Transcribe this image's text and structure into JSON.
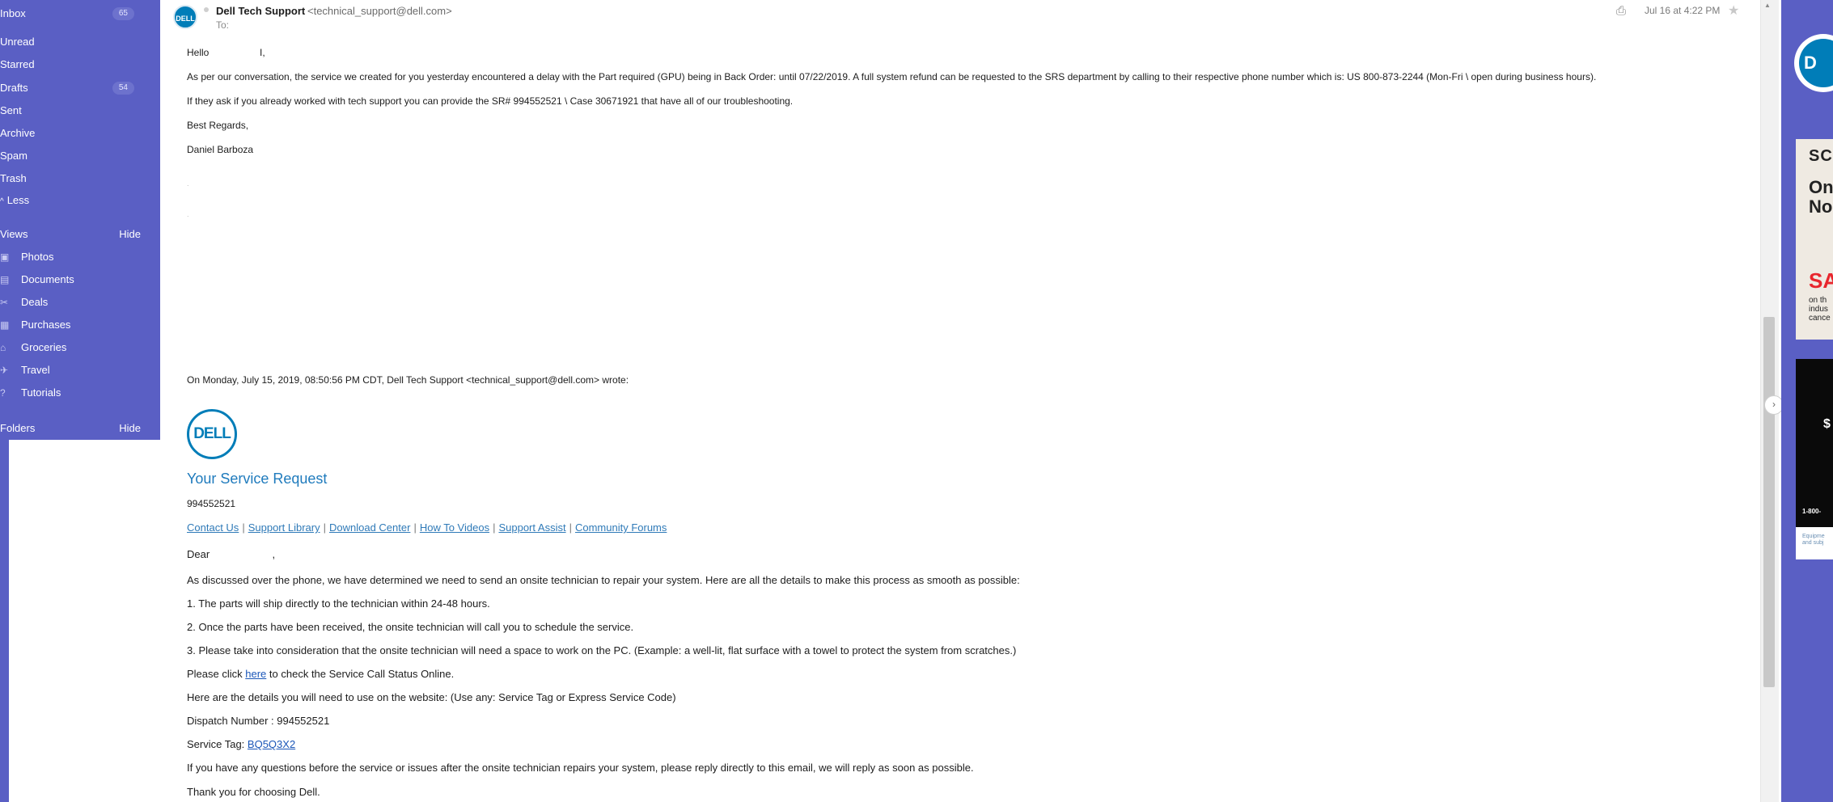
{
  "sidebar": {
    "folders_main": [
      {
        "label": "Inbox",
        "badge": "65"
      },
      {
        "label": "Unread",
        "badge": ""
      },
      {
        "label": "Starred",
        "badge": ""
      },
      {
        "label": "Drafts",
        "badge": "54"
      },
      {
        "label": "Sent",
        "badge": ""
      },
      {
        "label": "Archive",
        "badge": ""
      },
      {
        "label": "Spam",
        "badge": ""
      },
      {
        "label": "Trash",
        "badge": ""
      }
    ],
    "less_label": "Less",
    "views_header": "Views",
    "views_hide": "Hide",
    "views": [
      {
        "label": "Photos",
        "icon": "photo-icon"
      },
      {
        "label": "Documents",
        "icon": "document-icon"
      },
      {
        "label": "Deals",
        "icon": "scissors-icon"
      },
      {
        "label": "Purchases",
        "icon": "receipt-icon"
      },
      {
        "label": "Groceries",
        "icon": "basket-icon"
      },
      {
        "label": "Travel",
        "icon": "plane-icon"
      },
      {
        "label": "Tutorials",
        "icon": "help-icon"
      }
    ],
    "folders_header": "Folders",
    "folders_hide": "Hide"
  },
  "email": {
    "avatar_text": "DELL",
    "from_name": "Dell Tech Support",
    "from_address": "<technical_support@dell.com>",
    "to_label": "To:",
    "date": "Jul 16 at 4:22 PM",
    "greeting": "Hello",
    "greeting_end": "I,",
    "p1": "As per our conversation, the service we created for you yesterday encountered a delay with the Part required (GPU) being in Back Order: until 07/22/2019. A full system refund can be requested to the SRS department by calling to their respective phone number which is: US 800-873-2244 (Mon-Fri \\ open during business hours).",
    "p2": "If they ask if you already worked with tech support you can provide the SR# 994552521 \\ Case 30671921 that have all of our troubleshooting.",
    "signoff": "Best Regards,",
    "signer": "Daniel Barboza",
    "quote_header": "On Monday, July 15, 2019, 08:50:56 PM CDT, Dell Tech Support <technical_support@dell.com> wrote:"
  },
  "quoted": {
    "logo_text": "DELL",
    "title": "Your Service Request",
    "number": "994552521",
    "links": [
      "Contact Us",
      "Support Library",
      "Download Center",
      "How To Videos",
      "Support Assist",
      "Community Forums"
    ],
    "dear": "Dear",
    "dear_end": ",",
    "intro": "As discussed over the phone, we have determined we need to send an onsite technician to repair your system. Here are all the details to make this process as smooth as possible:",
    "step1": "1. The parts will ship directly to the technician within 24-48 hours.",
    "step2": "2. Once the parts have been received, the onsite technician will call you to schedule the service.",
    "step3": "3. Please take into consideration that the onsite technician will need a space to work on the PC. (Example: a well-lit, flat surface with a towel to protect the system from scratches.)",
    "click_pre": "Please click",
    "click_link": "here",
    "click_post": "to check the Service Call Status Online.",
    "details": "Here are the details you will need to use on the website: (Use any: Service Tag or Express Service Code)",
    "dispatch": "Dispatch Number : 994552521",
    "tag_label": "Service Tag:",
    "tag_value": "BQ5Q3X2",
    "questions": "If you have any questions before the service or issues after the onsite technician repairs your system, please reply directly to this email, we will reply as soon as possible.",
    "thanks": "Thank you for choosing Dell."
  },
  "ads": {
    "ad1_line1": "SC",
    "ad1_line2": "On",
    "ad1_line3": "No",
    "ad1_sale": "SA",
    "ad1_small": "on th indus cance",
    "ad2_price": "$",
    "ad2_phone": "1-800-",
    "ad2_fine": "Equipme and subj"
  },
  "colors": {
    "sidebar_bg": "#5a5fc4",
    "dell_blue": "#007db8",
    "link_blue": "#2f7ab8"
  }
}
